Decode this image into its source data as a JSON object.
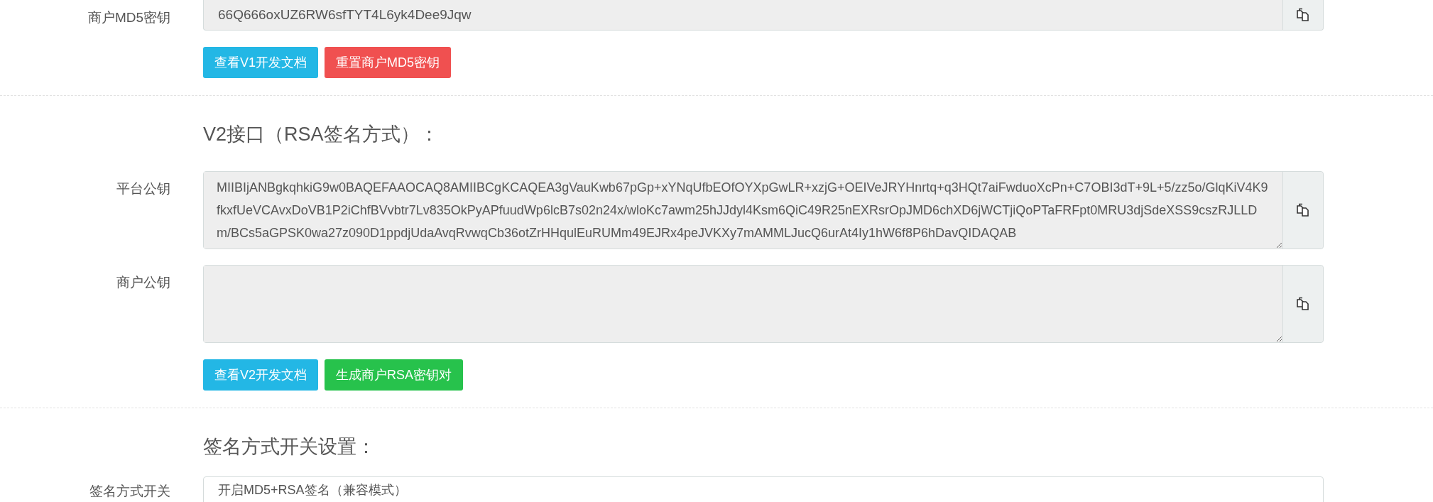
{
  "md5_section": {
    "field": {
      "label": "商户MD5密钥",
      "value": "66Q666oxUZ6RW6sfTYT4L6yk4Dee9Jqw"
    },
    "buttons": [
      {
        "label": "查看V1开发文档",
        "kind": "info"
      },
      {
        "label": "重置商户MD5密钥",
        "kind": "danger"
      }
    ]
  },
  "v2_section": {
    "heading": "V2接口（RSA签名方式）：",
    "fields": [
      {
        "label": "平台公钥",
        "value": "MIIBIjANBgkqhkiG9w0BAQEFAAOCAQ8AMIIBCgKCAQEA3gVauKwb67pGp+xYNqUfbEOfOYXpGwLR+xzjG+OEIVeJRYHnrtq+q3HQt7aiFwduoXcPn+C7OBI3dT+9L+5/zz5o/GlqKiV4K9fkxfUeVCAvxDoVB1P2iChfBVvbtr7Lv835OkPyAPfuudWp6lcB7s02n24x/wloKc7awm25hJJdyl4Ksm6QiC49R25nEXRsrOpJMD6chXD6jWCTjiQoPTaFRFpt0MRU3djSdeXSS9cszRJLLDm/BCs5aGPSK0wa27z090D1ppdjUdaAvqRvwqCb36otZrHHqulEuRUMm49EJRx4peJVKXy7mAMMLJucQ6urAt4Iy1hW6f8P6hDavQIDAQAB"
      },
      {
        "label": "商户公钥"
      }
    ],
    "buttons": [
      {
        "label": "查看V2开发文档",
        "kind": "info"
      },
      {
        "label": "生成商户RSA密钥对",
        "kind": "success"
      }
    ]
  },
  "switch_section": {
    "heading": "签名方式开关设置：",
    "field": {
      "label": "签名方式开关",
      "value": "开启MD5+RSA签名（兼容模式）"
    }
  }
}
